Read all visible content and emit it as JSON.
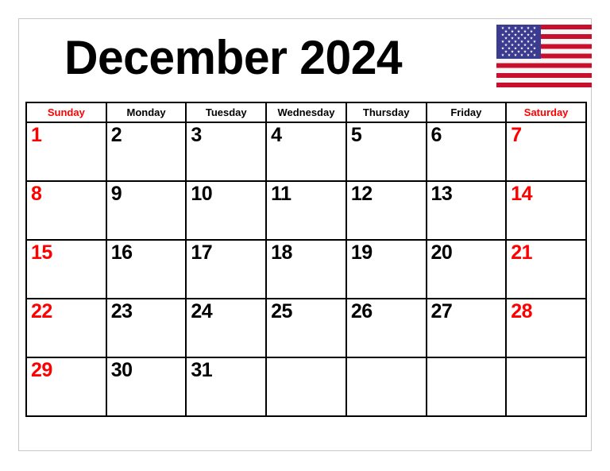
{
  "header": {
    "title": "December 2024",
    "flag": {
      "name": "united-states-flag",
      "canton_color": "#3b3b8f",
      "stripe_red": "#c8102e",
      "stripe_white": "#f7f7f7",
      "star_count": 50,
      "stripe_count": 13
    }
  },
  "calendar": {
    "month": "December",
    "year": "2024",
    "weekend_color": "#ff0000",
    "weekday_color": "#000000",
    "weekdays": [
      {
        "label": "Sunday",
        "weekend": true
      },
      {
        "label": "Monday",
        "weekend": false
      },
      {
        "label": "Tuesday",
        "weekend": false
      },
      {
        "label": "Wednesday",
        "weekend": false
      },
      {
        "label": "Thursday",
        "weekend": false
      },
      {
        "label": "Friday",
        "weekend": false
      },
      {
        "label": "Saturday",
        "weekend": true
      }
    ],
    "weeks": [
      [
        {
          "day": "1",
          "weekend": true
        },
        {
          "day": "2",
          "weekend": false
        },
        {
          "day": "3",
          "weekend": false
        },
        {
          "day": "4",
          "weekend": false
        },
        {
          "day": "5",
          "weekend": false
        },
        {
          "day": "6",
          "weekend": false
        },
        {
          "day": "7",
          "weekend": true
        }
      ],
      [
        {
          "day": "8",
          "weekend": true
        },
        {
          "day": "9",
          "weekend": false
        },
        {
          "day": "10",
          "weekend": false
        },
        {
          "day": "11",
          "weekend": false
        },
        {
          "day": "12",
          "weekend": false
        },
        {
          "day": "13",
          "weekend": false
        },
        {
          "day": "14",
          "weekend": true
        }
      ],
      [
        {
          "day": "15",
          "weekend": true
        },
        {
          "day": "16",
          "weekend": false
        },
        {
          "day": "17",
          "weekend": false
        },
        {
          "day": "18",
          "weekend": false
        },
        {
          "day": "19",
          "weekend": false
        },
        {
          "day": "20",
          "weekend": false
        },
        {
          "day": "21",
          "weekend": true
        }
      ],
      [
        {
          "day": "22",
          "weekend": true
        },
        {
          "day": "23",
          "weekend": false
        },
        {
          "day": "24",
          "weekend": false
        },
        {
          "day": "25",
          "weekend": false
        },
        {
          "day": "26",
          "weekend": false
        },
        {
          "day": "27",
          "weekend": false
        },
        {
          "day": "28",
          "weekend": true
        }
      ],
      [
        {
          "day": "29",
          "weekend": true
        },
        {
          "day": "30",
          "weekend": false
        },
        {
          "day": "31",
          "weekend": false
        },
        {
          "day": "",
          "weekend": false
        },
        {
          "day": "",
          "weekend": false
        },
        {
          "day": "",
          "weekend": false
        },
        {
          "day": "",
          "weekend": false
        }
      ]
    ]
  }
}
